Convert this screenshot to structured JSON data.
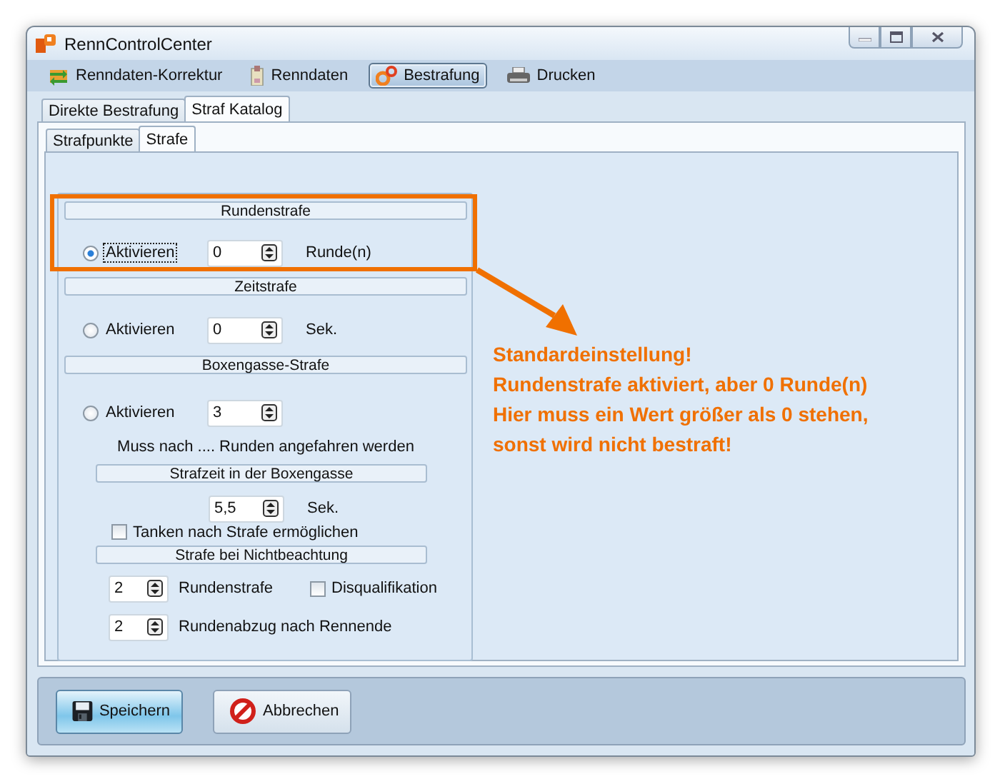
{
  "window": {
    "title": "RennControlCenter"
  },
  "toolbar": [
    {
      "label": "Renndaten-Korrektur",
      "selected": false
    },
    {
      "label": "Renndaten",
      "selected": false
    },
    {
      "label": "Bestrafung",
      "selected": true
    },
    {
      "label": "Drucken",
      "selected": false
    }
  ],
  "outer_tabs": [
    {
      "label": "Direkte Bestrafung",
      "selected": false
    },
    {
      "label": "Straf Katalog",
      "selected": true
    }
  ],
  "inner_tabs": [
    {
      "label": "Strafpunkte",
      "selected": false
    },
    {
      "label": "Strafe",
      "selected": true
    }
  ],
  "sections": [
    {
      "kind": "simple",
      "heading": "Rundenstrafe",
      "radio": {
        "label": "Aktivieren",
        "selected": true,
        "focused": true
      },
      "value": "0",
      "unit": "Runde(n)"
    },
    {
      "kind": "simple",
      "heading": "Zeitstrafe",
      "radio": {
        "label": "Aktivieren",
        "selected": false,
        "focused": false
      },
      "value": "0",
      "unit": "Sek."
    },
    {
      "kind": "pitlane",
      "heading": "Boxengasse-Strafe",
      "radio": {
        "label": "Aktivieren",
        "selected": false,
        "focused": false
      },
      "value": "3",
      "note": "Muss nach .... Runden angefahren werden",
      "subheading": "Strafzeit in der Boxengasse",
      "time_value": "5,5",
      "time_unit": "Sek.",
      "refuel": {
        "label": "Tanken nach Strafe ermöglichen",
        "checked": false
      }
    }
  ],
  "ignore_penalty": {
    "heading": "Strafe bei Nichtbeachtung",
    "rows": [
      {
        "value": "2",
        "label": "Rundenstrafe",
        "checkbox": {
          "label": "Disqualifikation",
          "checked": false
        }
      },
      {
        "value": "2",
        "label": "Rundenabzug nach Rennende"
      }
    ]
  },
  "annotation": {
    "lines": [
      "Standardeinstellung!",
      "Rundenstrafe aktiviert, aber 0 Runde(n)",
      "Hier muss ein Wert größer als 0 stehen,",
      "sonst wird nicht bestraft!"
    ]
  },
  "buttons": [
    {
      "label": "Speichern",
      "kind": "save",
      "default": true
    },
    {
      "label": "Abbrechen",
      "kind": "cancel",
      "default": false
    }
  ]
}
